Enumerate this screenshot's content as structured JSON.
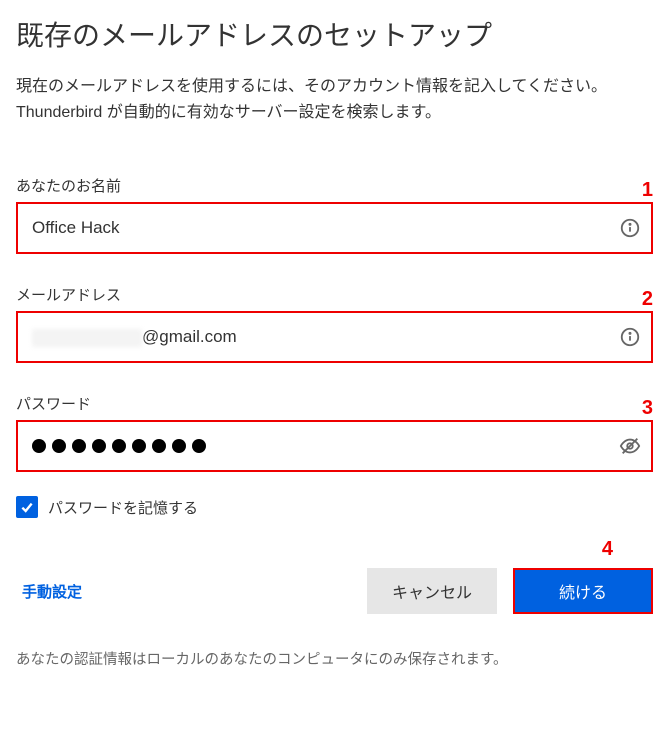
{
  "heading": "既存のメールアドレスのセットアップ",
  "description": "現在のメールアドレスを使用するには、そのアカウント情報を記入してください。Thunderbird が自動的に有効なサーバー設定を検索します。",
  "markers": {
    "m1": "1",
    "m2": "2",
    "m3": "3",
    "m4": "4"
  },
  "name": {
    "label": "あなたのお名前",
    "value": "Office Hack"
  },
  "email": {
    "label": "メールアドレス",
    "suffix": "@gmail.com"
  },
  "password": {
    "label": "パスワード",
    "dots": 9
  },
  "remember": {
    "label": "パスワードを記憶する",
    "checked": true
  },
  "actions": {
    "manual": "手動設定",
    "cancel": "キャンセル",
    "continue": "続ける"
  },
  "footer": "あなたの認証情報はローカルのあなたのコンピュータにのみ保存されます。"
}
